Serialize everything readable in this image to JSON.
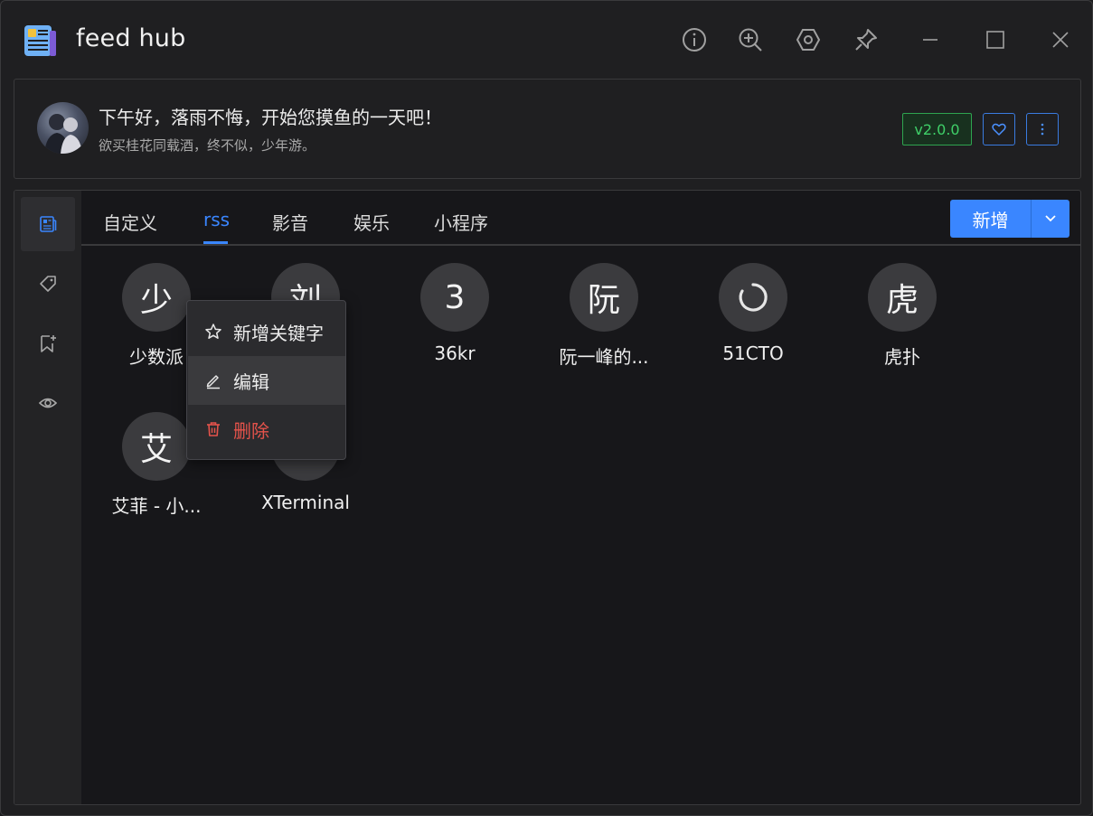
{
  "app": {
    "title": "feed hub"
  },
  "titlebar": {
    "icons": [
      "info-icon",
      "zoom-in-icon",
      "settings-hex-icon",
      "pin-icon",
      "minimize-icon",
      "maximize-icon",
      "close-icon"
    ]
  },
  "greeting": {
    "title": "下午好，落雨不悔，开始您摸鱼的一天吧！",
    "subtitle": "欲买桂花同载酒，终不似，少年游。",
    "version": "v2.0.0"
  },
  "sidebar": {
    "items": [
      {
        "icon": "newspaper-icon",
        "active": true
      },
      {
        "icon": "tag-icon",
        "active": false
      },
      {
        "icon": "bookmark-add-icon",
        "active": false
      },
      {
        "icon": "eye-icon",
        "active": false
      }
    ]
  },
  "tabs": {
    "items": [
      {
        "label": "自定义"
      },
      {
        "label": "rss"
      },
      {
        "label": "影音"
      },
      {
        "label": "娱乐"
      },
      {
        "label": "小程序"
      }
    ],
    "active": "rss",
    "add_label": "新增"
  },
  "feeds": [
    {
      "initial": "少",
      "label": "少数派"
    },
    {
      "initial": "刘",
      "label": ""
    },
    {
      "initial": "3",
      "label": "36kr"
    },
    {
      "initial": "阮",
      "label": "阮一峰的..."
    },
    {
      "initial": "",
      "label": "51CTO",
      "loading": true
    },
    {
      "initial": "虎",
      "label": "虎扑"
    },
    {
      "initial": "艾",
      "label": "艾菲 - 小..."
    },
    {
      "initial": "",
      "label": "XTerminal"
    }
  ],
  "context_menu": {
    "items": [
      {
        "label": "新增关键字",
        "icon": "star-icon"
      },
      {
        "label": "编辑",
        "icon": "edit-icon"
      },
      {
        "label": "删除",
        "icon": "trash-icon"
      }
    ]
  },
  "colors": {
    "accent": "#3a86ff",
    "success": "#3fcf68",
    "danger": "#e5534b",
    "background": "#17171a"
  }
}
